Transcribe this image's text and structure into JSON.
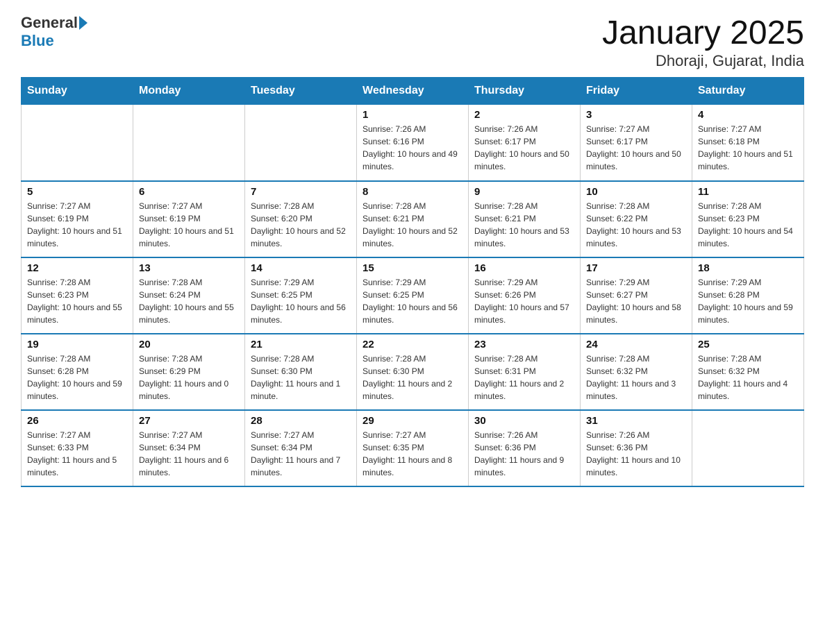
{
  "header": {
    "logo_general": "General",
    "logo_blue": "Blue",
    "title": "January 2025",
    "subtitle": "Dhoraji, Gujarat, India"
  },
  "weekdays": [
    "Sunday",
    "Monday",
    "Tuesday",
    "Wednesday",
    "Thursday",
    "Friday",
    "Saturday"
  ],
  "weeks": [
    [
      {
        "day": "",
        "info": ""
      },
      {
        "day": "",
        "info": ""
      },
      {
        "day": "",
        "info": ""
      },
      {
        "day": "1",
        "info": "Sunrise: 7:26 AM\nSunset: 6:16 PM\nDaylight: 10 hours and 49 minutes."
      },
      {
        "day": "2",
        "info": "Sunrise: 7:26 AM\nSunset: 6:17 PM\nDaylight: 10 hours and 50 minutes."
      },
      {
        "day": "3",
        "info": "Sunrise: 7:27 AM\nSunset: 6:17 PM\nDaylight: 10 hours and 50 minutes."
      },
      {
        "day": "4",
        "info": "Sunrise: 7:27 AM\nSunset: 6:18 PM\nDaylight: 10 hours and 51 minutes."
      }
    ],
    [
      {
        "day": "5",
        "info": "Sunrise: 7:27 AM\nSunset: 6:19 PM\nDaylight: 10 hours and 51 minutes."
      },
      {
        "day": "6",
        "info": "Sunrise: 7:27 AM\nSunset: 6:19 PM\nDaylight: 10 hours and 51 minutes."
      },
      {
        "day": "7",
        "info": "Sunrise: 7:28 AM\nSunset: 6:20 PM\nDaylight: 10 hours and 52 minutes."
      },
      {
        "day": "8",
        "info": "Sunrise: 7:28 AM\nSunset: 6:21 PM\nDaylight: 10 hours and 52 minutes."
      },
      {
        "day": "9",
        "info": "Sunrise: 7:28 AM\nSunset: 6:21 PM\nDaylight: 10 hours and 53 minutes."
      },
      {
        "day": "10",
        "info": "Sunrise: 7:28 AM\nSunset: 6:22 PM\nDaylight: 10 hours and 53 minutes."
      },
      {
        "day": "11",
        "info": "Sunrise: 7:28 AM\nSunset: 6:23 PM\nDaylight: 10 hours and 54 minutes."
      }
    ],
    [
      {
        "day": "12",
        "info": "Sunrise: 7:28 AM\nSunset: 6:23 PM\nDaylight: 10 hours and 55 minutes."
      },
      {
        "day": "13",
        "info": "Sunrise: 7:28 AM\nSunset: 6:24 PM\nDaylight: 10 hours and 55 minutes."
      },
      {
        "day": "14",
        "info": "Sunrise: 7:29 AM\nSunset: 6:25 PM\nDaylight: 10 hours and 56 minutes."
      },
      {
        "day": "15",
        "info": "Sunrise: 7:29 AM\nSunset: 6:25 PM\nDaylight: 10 hours and 56 minutes."
      },
      {
        "day": "16",
        "info": "Sunrise: 7:29 AM\nSunset: 6:26 PM\nDaylight: 10 hours and 57 minutes."
      },
      {
        "day": "17",
        "info": "Sunrise: 7:29 AM\nSunset: 6:27 PM\nDaylight: 10 hours and 58 minutes."
      },
      {
        "day": "18",
        "info": "Sunrise: 7:29 AM\nSunset: 6:28 PM\nDaylight: 10 hours and 59 minutes."
      }
    ],
    [
      {
        "day": "19",
        "info": "Sunrise: 7:28 AM\nSunset: 6:28 PM\nDaylight: 10 hours and 59 minutes."
      },
      {
        "day": "20",
        "info": "Sunrise: 7:28 AM\nSunset: 6:29 PM\nDaylight: 11 hours and 0 minutes."
      },
      {
        "day": "21",
        "info": "Sunrise: 7:28 AM\nSunset: 6:30 PM\nDaylight: 11 hours and 1 minute."
      },
      {
        "day": "22",
        "info": "Sunrise: 7:28 AM\nSunset: 6:30 PM\nDaylight: 11 hours and 2 minutes."
      },
      {
        "day": "23",
        "info": "Sunrise: 7:28 AM\nSunset: 6:31 PM\nDaylight: 11 hours and 2 minutes."
      },
      {
        "day": "24",
        "info": "Sunrise: 7:28 AM\nSunset: 6:32 PM\nDaylight: 11 hours and 3 minutes."
      },
      {
        "day": "25",
        "info": "Sunrise: 7:28 AM\nSunset: 6:32 PM\nDaylight: 11 hours and 4 minutes."
      }
    ],
    [
      {
        "day": "26",
        "info": "Sunrise: 7:27 AM\nSunset: 6:33 PM\nDaylight: 11 hours and 5 minutes."
      },
      {
        "day": "27",
        "info": "Sunrise: 7:27 AM\nSunset: 6:34 PM\nDaylight: 11 hours and 6 minutes."
      },
      {
        "day": "28",
        "info": "Sunrise: 7:27 AM\nSunset: 6:34 PM\nDaylight: 11 hours and 7 minutes."
      },
      {
        "day": "29",
        "info": "Sunrise: 7:27 AM\nSunset: 6:35 PM\nDaylight: 11 hours and 8 minutes."
      },
      {
        "day": "30",
        "info": "Sunrise: 7:26 AM\nSunset: 6:36 PM\nDaylight: 11 hours and 9 minutes."
      },
      {
        "day": "31",
        "info": "Sunrise: 7:26 AM\nSunset: 6:36 PM\nDaylight: 11 hours and 10 minutes."
      },
      {
        "day": "",
        "info": ""
      }
    ]
  ]
}
